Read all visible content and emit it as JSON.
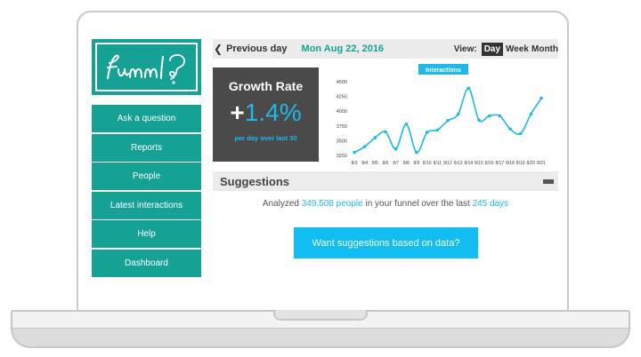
{
  "brand": {
    "logo_text": "funnl"
  },
  "sidebar": {
    "items": [
      {
        "label": "Ask a question"
      },
      {
        "label": "Reports"
      },
      {
        "label": "People"
      },
      {
        "label": "Latest interactions"
      },
      {
        "label": "Help"
      },
      {
        "label": "Dashboard"
      }
    ]
  },
  "topbar": {
    "prev_label": "Previous day",
    "date": "Mon Aug 22, 2016",
    "view_label": "View:",
    "view_options": [
      "Day",
      "Week",
      "Month"
    ],
    "view_selected": "Day"
  },
  "growth": {
    "title": "Growth Rate",
    "sign": "+",
    "value": "1.4%",
    "subtitle": "per day over last 30"
  },
  "chart_data": {
    "type": "line",
    "title": "Interactions",
    "categories": [
      "8/3",
      "8/4",
      "8/5",
      "8/6",
      "8/7",
      "8/8",
      "8/9",
      "8/10",
      "8/11",
      "8/12",
      "8/13",
      "8/14",
      "8/15",
      "8/16",
      "8/17",
      "8/18",
      "8/19",
      "8/20",
      "8/21"
    ],
    "values": [
      3300,
      3400,
      3550,
      3650,
      3360,
      3780,
      3300,
      3640,
      3680,
      3840,
      3950,
      4390,
      3850,
      3920,
      3920,
      3700,
      3620,
      3950,
      4220
    ],
    "yticks": [
      3250,
      3500,
      3750,
      4000,
      4250,
      4500
    ],
    "ylim": [
      3250,
      4500
    ],
    "color": "#1fb8e8"
  },
  "suggestions": {
    "title": "Suggestions",
    "analyzed_prefix": "Analyzed",
    "people_count": "349,508 people",
    "analyzed_mid": "in your funnel over the last",
    "days": "245 days",
    "cta_label": "Want suggestions based on data?"
  },
  "colors": {
    "teal": "#15a295",
    "blue": "#1fb8e8",
    "dark": "#4a4a4a"
  }
}
